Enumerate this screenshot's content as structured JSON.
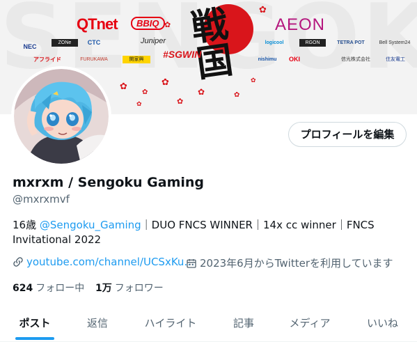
{
  "banner": {
    "watermark": "SENGOKU",
    "hashtag": "#SGWIN",
    "kanji": "戦国",
    "sponsors": {
      "qtnet": "QTnet",
      "bbiq": "BBIQ",
      "aeon": "AEON",
      "nec": "NEC",
      "zones": "ZONe",
      "ctc": "CTC",
      "juniper": "Juniper",
      "logicool": "logicool",
      "rgon": "RGON",
      "tetrapot": "TETRA POT",
      "bellsystem": "Bell System24",
      "afuraido": "アフライド",
      "furukawa": "FURUKAWA",
      "kansai": "関家興",
      "nishimu": "nishimu",
      "oki": "OKI",
      "shinko": "信光株式会社",
      "sumitomo": "住友電工"
    }
  },
  "profile": {
    "edit_button": "プロフィールを編集",
    "display_name": "mxrxm / Sengoku Gaming",
    "handle": "@mxrxmvf",
    "bio_prefix": "16歳 ",
    "bio_mention": "@Sengoku_Gaming",
    "bio_suffix": "｜DUO FNCS WINNER｜14x cc winner｜FNCS Invitational 2022",
    "link_text": "youtube.com/channel/UCSxKu…",
    "joined_text": "2023年6月からTwitterを利用しています",
    "following_count": "624",
    "following_label": "フォロー中",
    "followers_count": "1万",
    "followers_label": "フォロワー"
  },
  "tabs": [
    "ポスト",
    "返信",
    "ハイライト",
    "記事",
    "メディア",
    "いいね"
  ],
  "colors": {
    "accent": "#1d9bf0",
    "sengoku_red": "#d9151b",
    "text_primary": "#0f1419",
    "text_secondary": "#536471"
  }
}
